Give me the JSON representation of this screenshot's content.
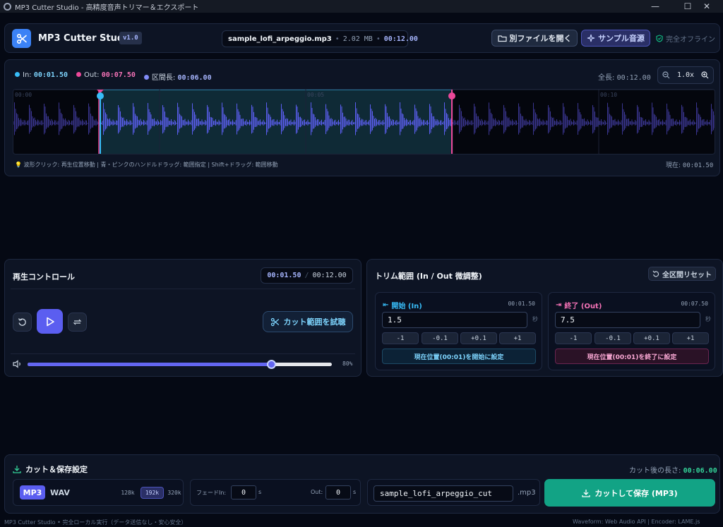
{
  "window": {
    "title": "MP3 Cutter Studio - 高精度音声トリマー＆エクスポート",
    "minimize": "—",
    "maximize": "☐",
    "close": "✕"
  },
  "header": {
    "app_name": "MP3 Cutter Studio",
    "version": "v1.0",
    "file_name": "sample_lofi_arpeggio.mp3",
    "file_size": "2.02 MB",
    "file_duration": "00:12.00",
    "open_label": "別ファイルを開く",
    "sample_label": "サンプル音源",
    "offline_label": "完全オフライン"
  },
  "timeline": {
    "in_label": "In:",
    "in_value": "00:01.50",
    "out_label": "Out:",
    "out_value": "00:07.50",
    "length_label": "区間長:",
    "length_value": "00:06.00",
    "total_label": "全長:",
    "total_value": "00:12.00",
    "zoom_value": "1.0x",
    "ticks": [
      "00:00",
      "00:05",
      "00:10"
    ],
    "hint": "波形クリック: 再生位置移動 | 青・ピンクのハンドルドラッグ: 範囲指定 | Shift+ドラッグ: 範囲移動",
    "current_label": "現在:",
    "current_value": "00:01.50"
  },
  "playback": {
    "title": "再生コントロール",
    "current": "00:01.50",
    "divider": "/",
    "total": "00:12.00",
    "try_label": "カット範囲を試聴",
    "volume_percent": 80,
    "volume_label": "80%"
  },
  "trim": {
    "title": "トリム範囲 (In / Out 微調整)",
    "reset_label": "全区間リセット",
    "start": {
      "label": "開始 (In)",
      "time": "00:01.50",
      "value": "1.5",
      "unit": "秒",
      "nudges": [
        "-1",
        "-0.1",
        "+0.1",
        "+1"
      ],
      "set_label": "現在位置(00:01)を開始に設定"
    },
    "end": {
      "label": "終了 (Out)",
      "time": "00:07.50",
      "value": "7.5",
      "unit": "秒",
      "nudges": [
        "-1",
        "-0.1",
        "+0.1",
        "+1"
      ],
      "set_label": "現在位置(00:01)を終了に設定"
    }
  },
  "export": {
    "title": "カット＆保存設定",
    "after_label": "カット後の長さ:",
    "after_value": "00:06.00",
    "formats": [
      "MP3",
      "WAV"
    ],
    "selected_format": "MP3",
    "bitrates": [
      "128k",
      "192k",
      "320k"
    ],
    "selected_bitrate": "192k",
    "fade_in_label": "フェードIn:",
    "fade_in_value": "0",
    "fade_out_label": "Out:",
    "fade_out_value": "0",
    "seconds_unit": "s",
    "filename": "sample_lofi_arpeggio_cut",
    "extension": ".mp3",
    "save_label": "カットして保存 (MP3)"
  },
  "footer": {
    "left": "MP3 Cutter Studio • 完全ローカル実行（データ送信なし・安心安全）",
    "right": "Waveform: Web Audio API | Encoder: LAME.js"
  },
  "colors": {
    "accent": "#6366f1",
    "in_marker": "#38bdf8",
    "out_marker": "#ec4899",
    "save": "#12a385"
  }
}
